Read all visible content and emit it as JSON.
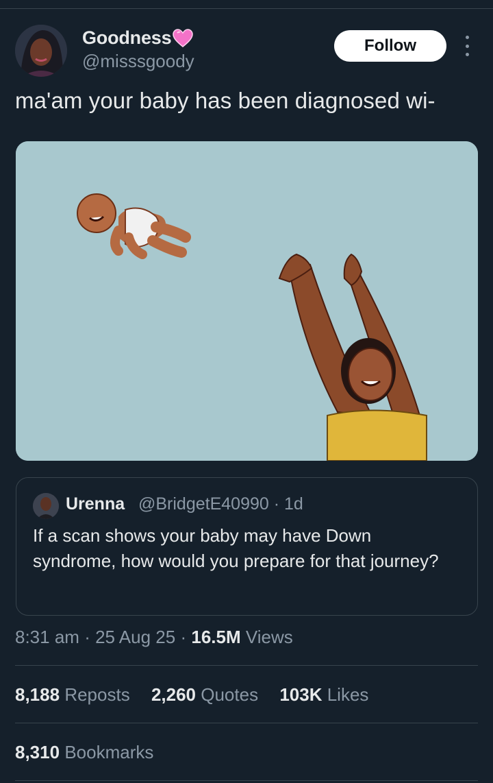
{
  "author": {
    "display_name": "Goodness",
    "handle": "@misssgoody",
    "follow_label": "Follow"
  },
  "tweet": {
    "text": "ma'am your baby has been diagnosed wi-"
  },
  "quote": {
    "name": "Urenna",
    "handle": "@BridgetE40990",
    "separator": "·",
    "time": "1d",
    "text": "If a scan shows your baby may have Down syndrome, how would you prepare for that journey?"
  },
  "meta": {
    "time": "8:31 am",
    "date": "25 Aug 25",
    "views_count": "16.5M",
    "views_label": "Views",
    "dot": "·"
  },
  "stats": {
    "reposts_count": "8,188",
    "reposts_label": "Reposts",
    "quotes_count": "2,260",
    "quotes_label": "Quotes",
    "likes_count": "103K",
    "likes_label": "Likes",
    "bookmarks_count": "8,310",
    "bookmarks_label": "Bookmarks"
  },
  "icons": {
    "verified_emoji": "pink-heart-icon",
    "menu": "more-options-icon"
  },
  "colors": {
    "background": "#15202b",
    "text": "#e7e9ea",
    "muted": "#8b98a5",
    "divider": "#38444d",
    "heart": "#f472c8"
  }
}
